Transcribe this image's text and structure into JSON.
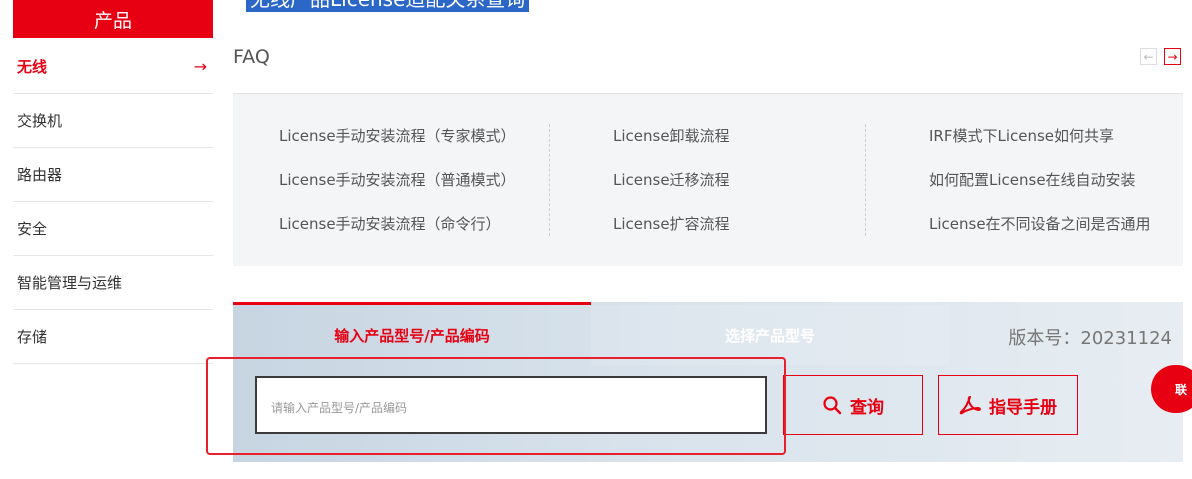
{
  "top_title": "无线产品License适配关系查询",
  "sidebar": {
    "header": "产品",
    "items": [
      {
        "label": "无线",
        "active": true
      },
      {
        "label": "交换机"
      },
      {
        "label": "路由器"
      },
      {
        "label": "安全"
      },
      {
        "label": "智能管理与运维"
      },
      {
        "label": "存储"
      }
    ],
    "active_arrow": "→"
  },
  "faq": {
    "title": "FAQ",
    "prev_icon": "←",
    "next_icon": "→",
    "columns": [
      [
        "License手动安装流程（专家模式）",
        "License手动安装流程（普通模式）",
        "License手动安装流程（命令行）"
      ],
      [
        "License卸载流程",
        "License迁移流程",
        "License扩容流程"
      ],
      [
        "IRF模式下License如何共享",
        "如何配置License在线自动安装",
        "License在不同设备之间是否通用"
      ]
    ]
  },
  "query": {
    "tabs": [
      "输入产品型号/产品编码",
      "选择产品型号"
    ],
    "version": "版本号：20231124",
    "input_placeholder": "请输入产品型号/产品编码",
    "input_value": "",
    "query_button": "查询",
    "manual_button": "指导手册"
  },
  "contact": {
    "label": "联"
  },
  "colors": {
    "accent": "#e60012",
    "highlight": "#2b67c6",
    "annotation": "#e8202b"
  }
}
